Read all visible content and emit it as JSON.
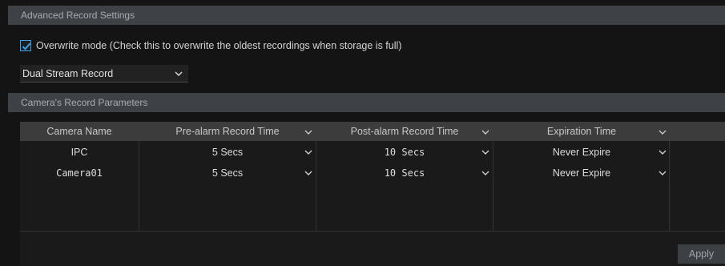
{
  "advanced": {
    "header": "Advanced Record Settings",
    "overwrite_checked": true,
    "overwrite_label": "Overwrite mode (Check this to overwrite the oldest recordings when storage is full)",
    "stream_mode": "Dual Stream Record"
  },
  "camera_params": {
    "header": "Camera's Record Parameters",
    "columns": [
      "Camera Name",
      "Pre-alarm Record Time",
      "Post-alarm Record Time",
      "Expiration Time"
    ],
    "rows": [
      {
        "camera": "IPC",
        "pre_alarm": "5 Secs",
        "post_alarm": "10 Secs",
        "expiration": "Never Expire"
      },
      {
        "camera": "Camera01",
        "pre_alarm": "5 Secs",
        "post_alarm": "10 Secs",
        "expiration": "Never Expire"
      }
    ]
  },
  "apply_label": "Apply",
  "colors": {
    "accent": "#3aa0e8",
    "header_bg": "#3e4247",
    "background": "#141414"
  },
  "icons": {
    "checkbox": "check-icon",
    "dropdown": "chevron-down-icon"
  }
}
